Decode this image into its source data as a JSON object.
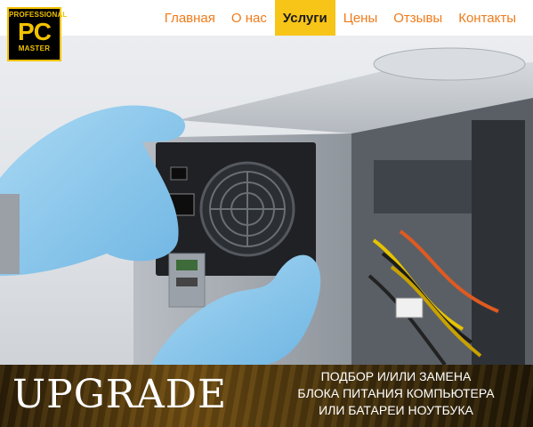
{
  "logo": {
    "top": "PROFESSIONAL",
    "main": "PC",
    "bottom": "MASTER"
  },
  "nav": {
    "items": [
      {
        "label": "Главная",
        "active": false
      },
      {
        "label": "О нас",
        "active": false
      },
      {
        "label": "Услуги",
        "active": true
      },
      {
        "label": "Цены",
        "active": false
      },
      {
        "label": "Отзывы",
        "active": false
      },
      {
        "label": "Контакты",
        "active": false
      }
    ]
  },
  "banner": {
    "title": "UPGRADE",
    "lines": [
      "ПОДБОР И/ИЛИ ЗАМЕНА",
      "БЛОКА ПИТАНИЯ КОМПЬЮТЕРА",
      "ИЛИ  БАТАРЕИ НОУТБУКА"
    ]
  },
  "colors": {
    "nav_text": "#ef7b1a",
    "nav_active_bg": "#f7c418",
    "logo_accent": "#f2c200"
  }
}
